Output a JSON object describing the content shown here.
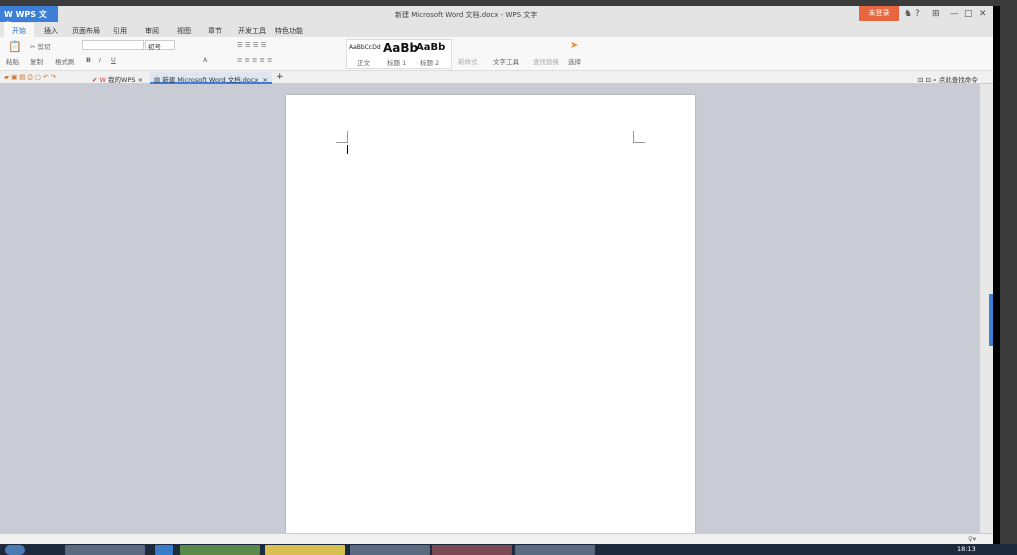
{
  "app": {
    "name": "WPS 文字",
    "title": "新建 Microsoft Word 文档.docx - WPS 文字",
    "login": "未登录",
    "help": "?"
  },
  "menu_tabs": [
    "开始",
    "插入",
    "页面布局",
    "引用",
    "审阅",
    "视图",
    "章节",
    "开发工具",
    "特色功能"
  ],
  "ribbon": {
    "paste": "粘贴",
    "cut": "剪切",
    "copy": "复制",
    "format_painter": "格式刷",
    "font_size": "初号",
    "styles": [
      {
        "preview": "AaBbCcDd",
        "label": "正文"
      },
      {
        "preview": "AaBb",
        "label": "标题 1"
      },
      {
        "preview": "AaBb",
        "label": "标题 2"
      }
    ],
    "new_style": "新样式",
    "text_tools": "文字工具",
    "find_replace": "查找替换",
    "select": "选择"
  },
  "doc_tabs": [
    {
      "label": "我的WPS"
    },
    {
      "label": "新建 Microsoft Word 文档.docx"
    }
  ],
  "command_search": "点此查找命令",
  "taskbar": {
    "clock": "18:13"
  }
}
